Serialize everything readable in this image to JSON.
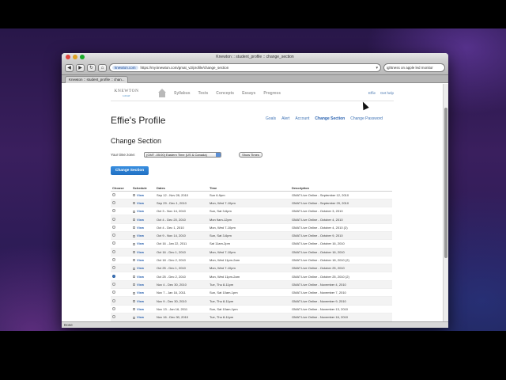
{
  "browser": {
    "window_title": "Knewton :: student_profile :: change_section",
    "site_badge": "knewton.com",
    "url": "https://my.knewton.com/gmat_v2/profile/change_section",
    "search_text": "ightness on apple led monitor",
    "tab_label": "Knewton :: student_profile :: chan...",
    "status": "Done"
  },
  "header": {
    "logo_main": "KNEWTON",
    "logo_sub": "GMAT",
    "nav": [
      "Syllabus",
      "Tests",
      "Concepts",
      "Essays",
      "Progress"
    ],
    "user_link": "Effie",
    "help_link": "Get help"
  },
  "profile": {
    "title": "Effie's Profile",
    "links": {
      "goals": "Goals",
      "alert": "Alert",
      "account": "Account",
      "change_section": "Change Section",
      "change_password": "Change Password"
    },
    "section_title": "Change Section",
    "timezone_label": "Your time zone:",
    "timezone_value": "(GMT -05:00) Eastern Time (US & Canada)",
    "show_times": "Show Times",
    "change_button": "Change Section"
  },
  "table": {
    "headers": [
      "Choose",
      "Schedule",
      "Dates",
      "Time",
      "Description"
    ],
    "view_label": "View",
    "rows": [
      {
        "dates": "Sep 12 - Nov 28, 2010",
        "time": "Sun 6-9pm",
        "desc": "GMAT Live Online - September 12, 2010",
        "selected": false
      },
      {
        "dates": "Sep 29 - Dec 1, 2010",
        "time": "Mon, Wed 7-10pm",
        "desc": "GMAT Live Online - September 29, 2010",
        "selected": false
      },
      {
        "dates": "Oct 3 - Nov 14, 2010",
        "time": "Sun, Sat 3-6pm",
        "desc": "GMAT Live Online - October 3, 2010",
        "selected": false
      },
      {
        "dates": "Oct 4 - Dec 20, 2010",
        "time": "Mon 9am-12pm",
        "desc": "GMAT Live Online - October 4, 2010",
        "selected": false
      },
      {
        "dates": "Oct 4 - Dec 1, 2010",
        "time": "Mon, Wed 7-10pm",
        "desc": "GMAT Live Online - October 4, 2010 (2)",
        "selected": false
      },
      {
        "dates": "Oct 9 - Nov 14, 2010",
        "time": "Sun, Sat 3-6pm",
        "desc": "GMAT Live Online - October 9, 2010",
        "selected": false
      },
      {
        "dates": "Oct 16 - Jan 22, 2011",
        "time": "Sat 11am-2pm",
        "desc": "GMAT Live Online - October 16, 2010",
        "selected": false
      },
      {
        "dates": "Oct 16 - Dec 1, 2010",
        "time": "Mon, Wed 7-10pm",
        "desc": "GMAT Live Online - October 16, 2010",
        "selected": false
      },
      {
        "dates": "Oct 18 - Dec 2, 2010",
        "time": "Mon, Wed 11pm-2am",
        "desc": "GMAT Live Online - October 18, 2010 (2)",
        "selected": false
      },
      {
        "dates": "Oct 25 - Dec 1, 2010",
        "time": "Mon, Wed 7-10pm",
        "desc": "GMAT Live Online - October 25, 2010",
        "selected": false
      },
      {
        "dates": "Oct 25 - Dec 2, 2010",
        "time": "Mon, Wed 11pm-2am",
        "desc": "GMAT Live Online - October 25, 2010 (2)",
        "selected": true
      },
      {
        "dates": "Nov 4 - Dec 30, 2010",
        "time": "Tue, Thu 8-11pm",
        "desc": "GMAT Live Online - November 4, 2010",
        "selected": false
      },
      {
        "dates": "Nov 7 - Jan 16, 2011",
        "time": "Sun, Sat 10am-1pm",
        "desc": "GMAT Live Online - November 7, 2010",
        "selected": false
      },
      {
        "dates": "Nov 9 - Dec 30, 2010",
        "time": "Tue, Thu 8-11pm",
        "desc": "GMAT Live Online - November 9, 2010",
        "selected": false
      },
      {
        "dates": "Nov 13 - Jan 16, 2011",
        "time": "Sun, Sat 10am-1pm",
        "desc": "GMAT Live Online - November 13, 2010",
        "selected": false
      },
      {
        "dates": "Nov 16 - Dec 30, 2010",
        "time": "Tue, Thu 8-11pm",
        "desc": "GMAT Live Online - November 16, 2010",
        "selected": false
      }
    ]
  }
}
